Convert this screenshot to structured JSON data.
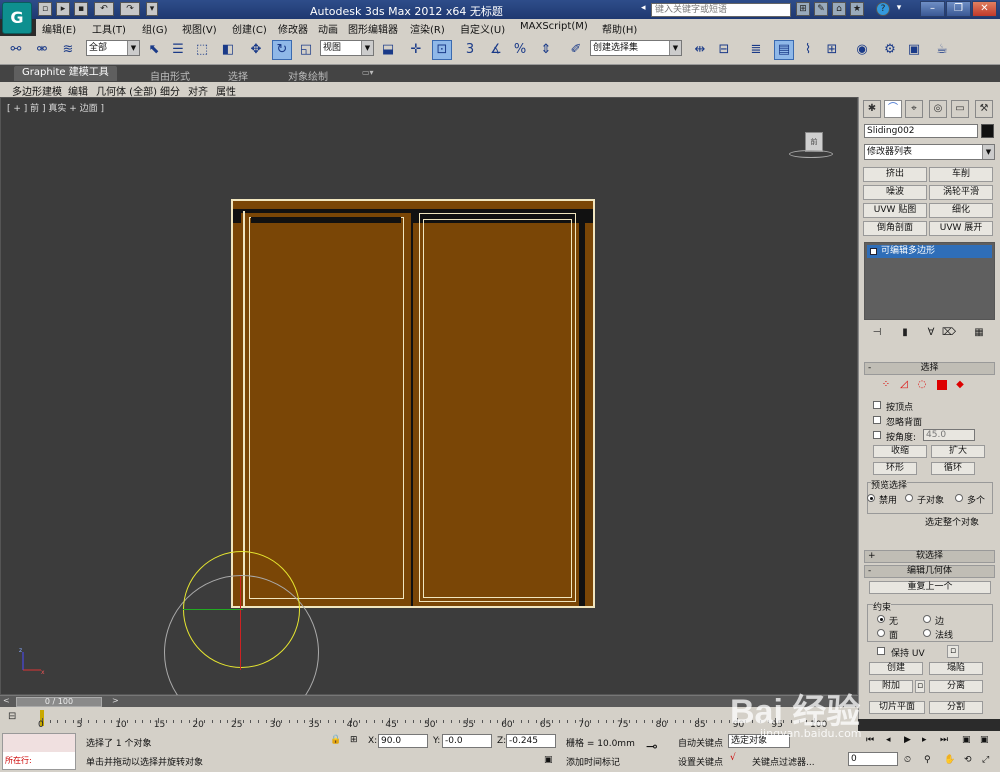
{
  "window": {
    "title": "Autodesk 3ds Max  2012 x64      无标题",
    "search_placeholder": "键入关键字或短语",
    "logo": "G"
  },
  "menu": [
    "编辑(E)",
    "工具(T)",
    "组(G)",
    "视图(V)",
    "创建(C)",
    "修改器",
    "动画",
    "图形编辑器",
    "渲染(R)",
    "自定义(U)",
    "MAXScript(M)",
    "帮助(H)"
  ],
  "toolbar": {
    "selection_filter": "全部",
    "reference_coord": "视图",
    "named_selection": "创建选择集"
  },
  "ribbon": {
    "tabs": [
      "Graphite 建模工具",
      "自由形式",
      "选择",
      "对象绘制"
    ],
    "panels": [
      "多边形建模",
      "编辑",
      "几何体 (全部)",
      "细分",
      "对齐",
      "属性"
    ]
  },
  "viewport": {
    "label": "[ + ] 前 ] 真实 + 边面 ]",
    "viewcube_label": "前"
  },
  "command_panel": {
    "object_name": "Sliding002",
    "modifier_list": "修改器列表",
    "modifier_buttons": [
      "挤出",
      "车削",
      "噪波",
      "涡轮平滑",
      "UVW 贴图",
      "细化",
      "倒角剖面",
      "UVW 展开"
    ],
    "stack_item": "可编辑多边形",
    "selection": {
      "header": "选择",
      "by_vertex": "按顶点",
      "ignore_backfacing": "忽略背面",
      "by_angle": "按角度:",
      "angle_value": "45.0",
      "shrink": "收缩",
      "grow": "扩大",
      "ring": "环形",
      "loop": "循环",
      "preview_label": "预览选择",
      "preview_options": [
        "禁用",
        "子对象",
        "多个"
      ],
      "status": "选定整个对象"
    },
    "soft_selection": "软选择",
    "edit_geometry": {
      "header": "编辑几何体",
      "repeat_last": "重复上一个",
      "constraints_label": "约束",
      "constraints": [
        "无",
        "边",
        "面",
        "法线"
      ],
      "preserve_uv": "保持 UV",
      "create": "创建",
      "collapse": "塌陷",
      "attach": "附加",
      "detach": "分离",
      "slice_plane": "切片平面",
      "split": "分割"
    }
  },
  "timeline": {
    "frame": "0 / 100",
    "ticks": [
      "0",
      "5",
      "10",
      "15",
      "20",
      "25",
      "30",
      "35",
      "40",
      "45",
      "50",
      "55",
      "60",
      "65",
      "70",
      "75",
      "80",
      "85",
      "90",
      "95",
      "100"
    ]
  },
  "status": {
    "maxscript_prompt": "所在行:",
    "selection_info": "选择了 1 个对象",
    "prompt": "单击并拖动以选择并旋转对象",
    "x_label": "X:",
    "x": "90.0",
    "y_label": "Y:",
    "y": "-0.0",
    "z_label": "Z:",
    "z": "-0.245",
    "grid": "栅格 = 10.0mm",
    "add_time_tag": "添加时间标记",
    "auto_key": "自动关键点",
    "selected": "选定对象",
    "set_key": "设置关键点",
    "key_filters": "关键点过滤器...",
    "current_frame": "0"
  },
  "watermark": {
    "brand": "Bai  经验",
    "url": "jingyan.baidu.com"
  }
}
